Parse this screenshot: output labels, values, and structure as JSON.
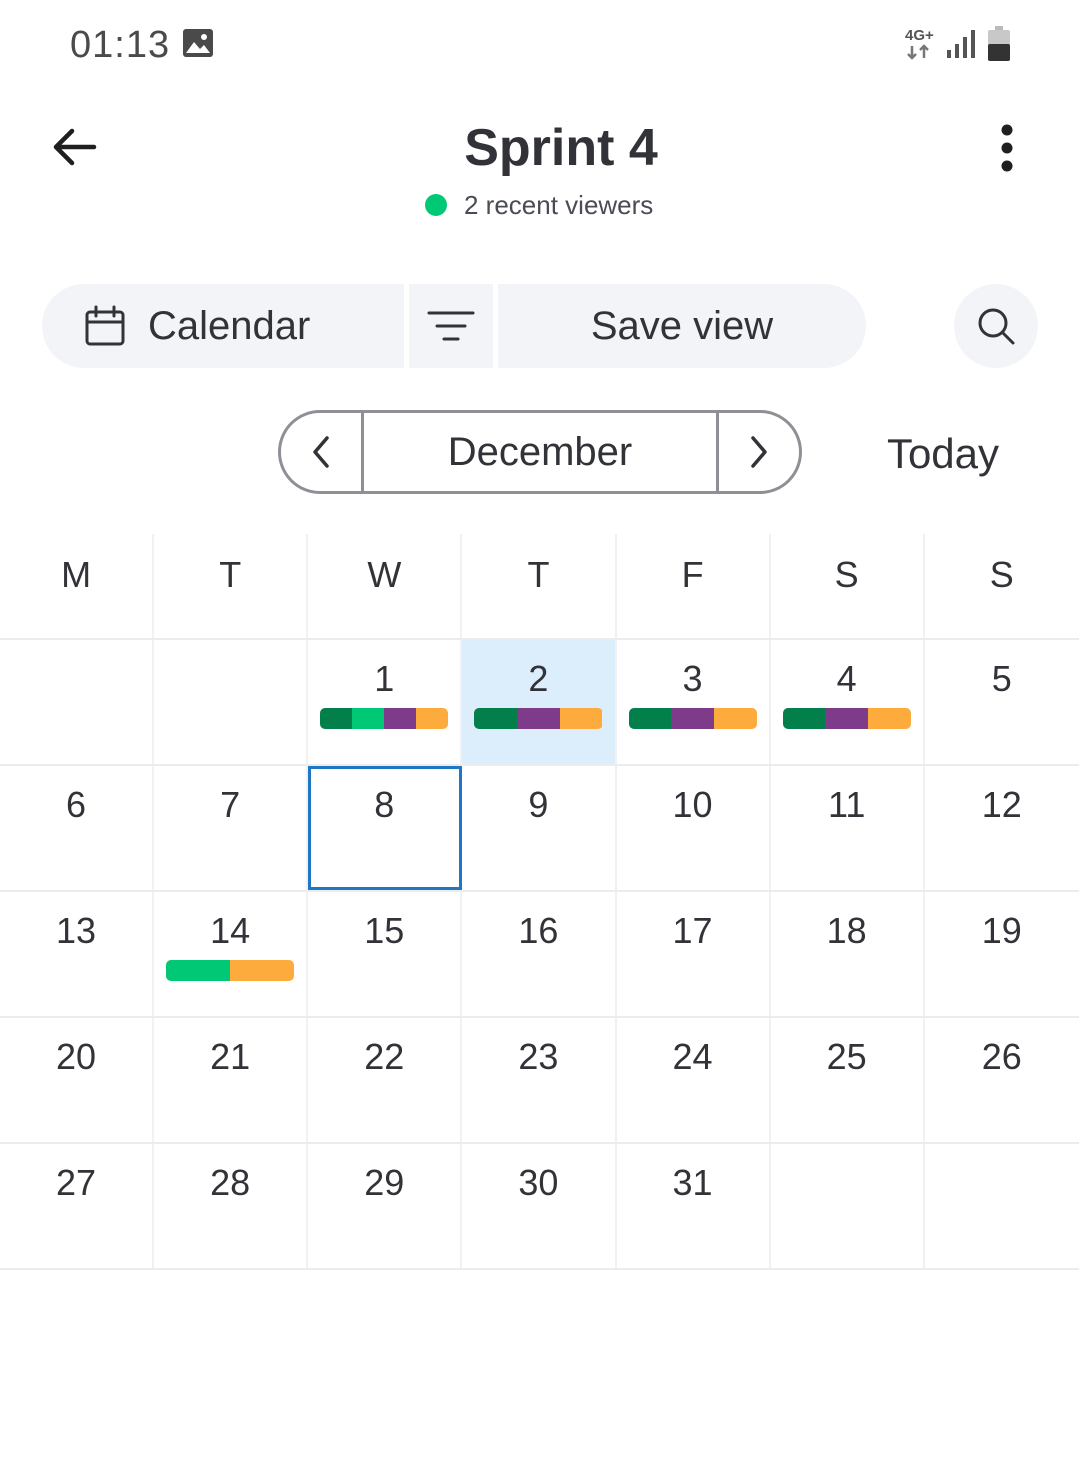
{
  "status_bar": {
    "time": "01:13",
    "network": "4G+",
    "icons": [
      "image-icon",
      "network-arrows-icon",
      "signal-icon",
      "battery-icon"
    ]
  },
  "header": {
    "title": "Sprint 4",
    "viewers_text": "2 recent viewers",
    "viewers_dot_color": "#00c875"
  },
  "toolbar": {
    "view_label": "Calendar",
    "save_view_label": "Save view"
  },
  "month_nav": {
    "month": "December",
    "today_label": "Today"
  },
  "colors": {
    "dark_green": "#037f4c",
    "green": "#00c875",
    "purple": "#784bd1",
    "dark_purple": "#7e3b8a",
    "orange": "#fdab3d",
    "today_bg": "#dcedfc",
    "selected_border": "#1f76c2"
  },
  "calendar": {
    "weekdays": [
      "M",
      "T",
      "W",
      "T",
      "F",
      "S",
      "S"
    ],
    "weeks": [
      [
        {
          "day": ""
        },
        {
          "day": ""
        },
        {
          "day": "1",
          "segments": [
            "#037f4c",
            "#00c875",
            "#7e3b8a",
            "#fdab3d"
          ]
        },
        {
          "day": "2",
          "today": true,
          "segments": [
            "#037f4c",
            "#7e3b8a",
            "#fdab3d"
          ]
        },
        {
          "day": "3",
          "segments": [
            "#037f4c",
            "#7e3b8a",
            "#fdab3d"
          ]
        },
        {
          "day": "4",
          "segments": [
            "#037f4c",
            "#7e3b8a",
            "#fdab3d"
          ]
        },
        {
          "day": "5"
        }
      ],
      [
        {
          "day": "6"
        },
        {
          "day": "7"
        },
        {
          "day": "8",
          "selected": true
        },
        {
          "day": "9"
        },
        {
          "day": "10"
        },
        {
          "day": "11"
        },
        {
          "day": "12"
        }
      ],
      [
        {
          "day": "13"
        },
        {
          "day": "14",
          "segments": [
            "#00c875",
            "#fdab3d"
          ]
        },
        {
          "day": "15"
        },
        {
          "day": "16"
        },
        {
          "day": "17"
        },
        {
          "day": "18"
        },
        {
          "day": "19"
        }
      ],
      [
        {
          "day": "20"
        },
        {
          "day": "21"
        },
        {
          "day": "22"
        },
        {
          "day": "23"
        },
        {
          "day": "24"
        },
        {
          "day": "25"
        },
        {
          "day": "26"
        }
      ],
      [
        {
          "day": "27"
        },
        {
          "day": "28"
        },
        {
          "day": "29"
        },
        {
          "day": "30"
        },
        {
          "day": "31"
        },
        {
          "day": ""
        },
        {
          "day": ""
        }
      ]
    ]
  }
}
